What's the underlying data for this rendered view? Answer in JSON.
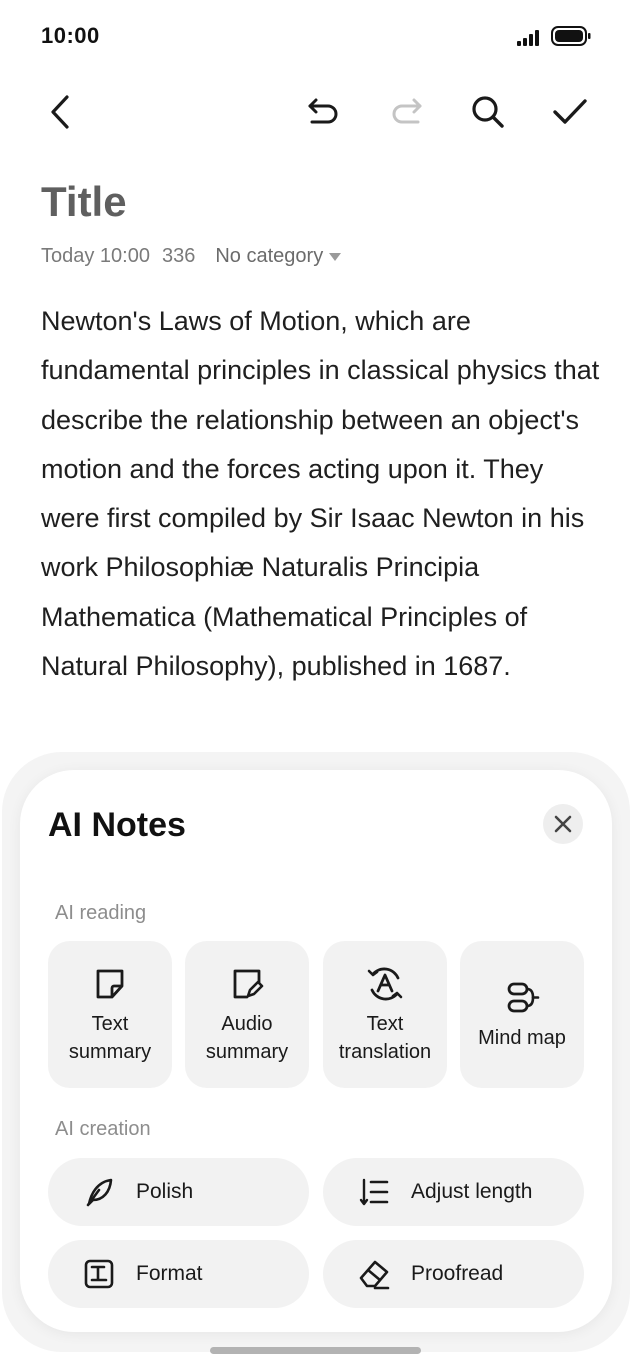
{
  "status_bar": {
    "time": "10:00"
  },
  "note": {
    "title": "Title",
    "meta_date": "Today 10:00",
    "meta_count": "336",
    "category": "No category",
    "body": "Newton's Laws of Motion, which are fundamental principles in classical physics that describe the relationship between an object's motion and the forces acting upon it. They were first compiled by Sir Isaac Newton in his work Philosophiæ Naturalis Principia Mathematica (Mathematical Principles of Natural Philosophy), published in 1687."
  },
  "ai_panel": {
    "title": "AI Notes",
    "reading_label": "AI reading",
    "reading_items": [
      {
        "label": "Text\nsummary",
        "icon": "text-summary-icon"
      },
      {
        "label": "Audio\nsummary",
        "icon": "audio-summary-icon"
      },
      {
        "label": "Text\ntranslation",
        "icon": "translate-icon"
      },
      {
        "label": "Mind map",
        "icon": "mind-map-icon"
      }
    ],
    "creation_label": "AI creation",
    "creation_items": [
      {
        "label": "Polish",
        "icon": "polish-icon"
      },
      {
        "label": "Adjust length",
        "icon": "adjust-length-icon"
      },
      {
        "label": "Format",
        "icon": "format-icon"
      },
      {
        "label": "Proofread",
        "icon": "proofread-icon"
      }
    ]
  },
  "colors": {
    "muted_icon": "#c4c4c4",
    "card_bg": "#f2f2f2",
    "title_gray": "#5f5f5f"
  }
}
